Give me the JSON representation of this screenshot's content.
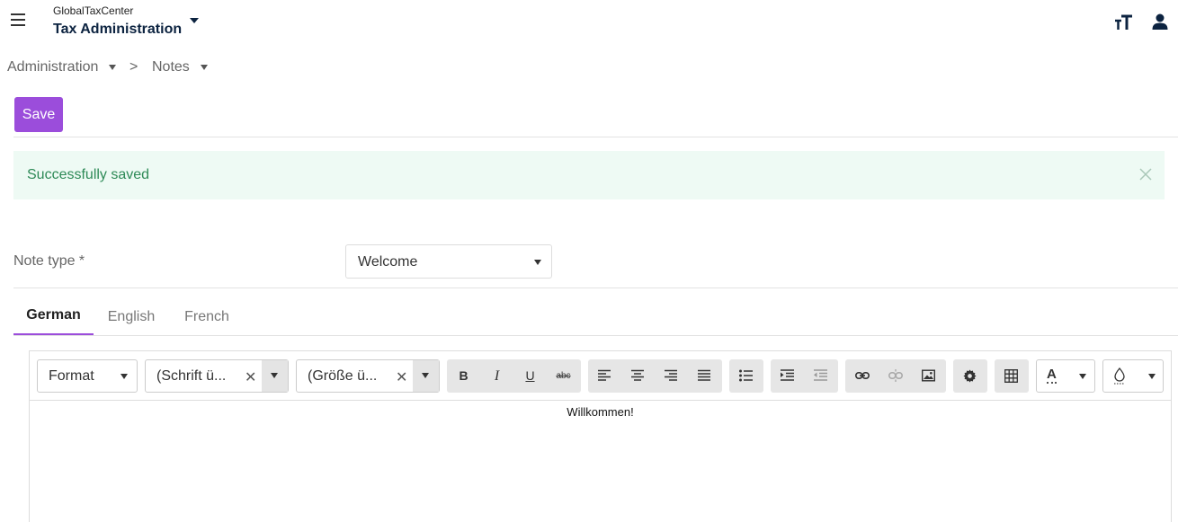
{
  "header": {
    "subtitle": "GlobalTaxCenter",
    "title": "Tax Administration"
  },
  "breadcrumb": {
    "items": [
      "Administration",
      "Notes"
    ],
    "separator": ">"
  },
  "actions": {
    "save_label": "Save"
  },
  "alert": {
    "message": "Successfully saved"
  },
  "form": {
    "note_type_label": "Note type *",
    "note_type_value": "Welcome"
  },
  "tabs": [
    {
      "label": "German",
      "active": true
    },
    {
      "label": "English",
      "active": false
    },
    {
      "label": "French",
      "active": false
    }
  ],
  "editor": {
    "format_label": "Format",
    "font_placeholder": "(Schrift ü...",
    "size_placeholder": "(Größe ü...",
    "clear_symbol": "✕",
    "bold": "B",
    "italic": "I",
    "underline": "U",
    "strike": "abc",
    "text_color_letter": "A",
    "content": "Willkommen!"
  },
  "colors": {
    "accent": "#9b4ddb",
    "alert_bg": "#eefaf4",
    "alert_text": "#2e8a57",
    "title": "#0c2340"
  }
}
